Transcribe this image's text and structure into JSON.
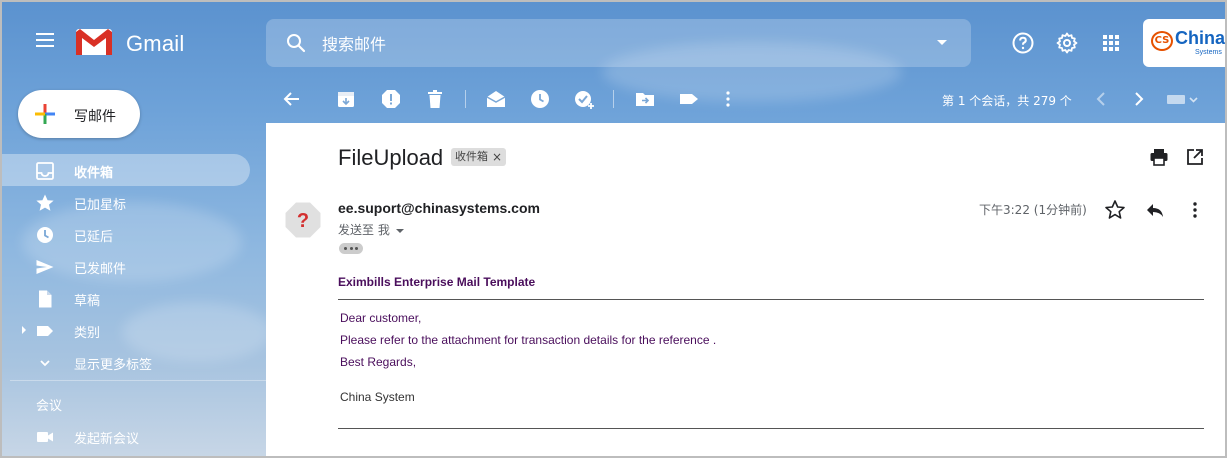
{
  "app": {
    "name": "Gmail"
  },
  "search": {
    "placeholder": "搜索邮件"
  },
  "brand": {
    "name": "China",
    "sub": "Systems",
    "badge": "CS"
  },
  "compose": {
    "label": "写邮件"
  },
  "sidebar": {
    "items": [
      {
        "label": "收件箱",
        "icon": "inbox-icon",
        "active": true
      },
      {
        "label": "已加星标",
        "icon": "star-icon"
      },
      {
        "label": "已延后",
        "icon": "clock-icon"
      },
      {
        "label": "已发邮件",
        "icon": "send-icon"
      },
      {
        "label": "草稿",
        "icon": "draft-icon"
      },
      {
        "label": "类别",
        "icon": "label-icon"
      },
      {
        "label": "显示更多标签",
        "icon": "chevron-down-icon"
      }
    ],
    "meet_title": "会议",
    "meet_item": "发起新会议"
  },
  "toolbar": {
    "count_text": "第 1 个会话，共 279 个"
  },
  "message": {
    "subject": "FileUpload",
    "label_chip": "收件箱",
    "label_chip_close": "×",
    "sender": "ee.suport@chinasystems.com",
    "to_line": "发送至 我",
    "time": "下午3:22 (1分钟前)",
    "template_title": "Eximbills Enterprise Mail Template",
    "body": {
      "greeting": "Dear customer,",
      "line1": "Please refer to the attachment for transaction details for the reference .",
      "closing": "Best Regards,",
      "signature": "China System"
    }
  },
  "colors": {
    "accent": "#4a0e5c",
    "backdrop": "#6fa3d9"
  }
}
